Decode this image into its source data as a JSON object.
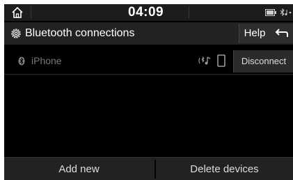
{
  "status_bar": {
    "time": "04:09",
    "icons": [
      "home-icon",
      "battery-icon",
      "bluetooth-audio-icon"
    ]
  },
  "header": {
    "title": "Bluetooth connections",
    "help_label": "Help",
    "icons": [
      "settings-gear-icon",
      "back-arrow-icon"
    ]
  },
  "devices": [
    {
      "name": "iPhone",
      "action_label": "Disconnect",
      "icons": [
        "bluetooth-icon",
        "bluetooth-audio-icon",
        "phone-icon"
      ]
    }
  ],
  "footer": {
    "add_label": "Add new",
    "delete_label": "Delete devices"
  },
  "colors": {
    "background": "#000000",
    "bar": "#222222",
    "text": "#ffffff",
    "muted_text": "#777777"
  }
}
